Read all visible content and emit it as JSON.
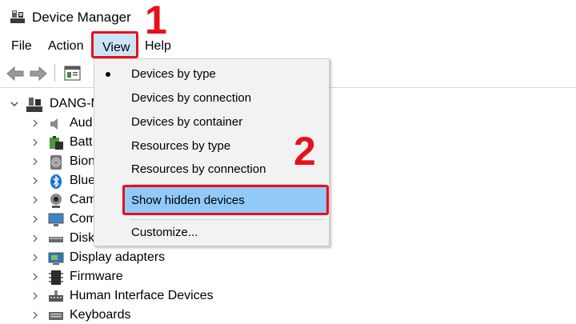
{
  "window": {
    "title": "Device Manager"
  },
  "menubar": {
    "file": "File",
    "action": "Action",
    "view": "View",
    "help": "Help"
  },
  "tree": {
    "root": "DANG-M",
    "items": [
      {
        "label": "Aud",
        "icon": "speaker-icon"
      },
      {
        "label": "Batt",
        "icon": "battery-icon"
      },
      {
        "label": "Bion",
        "icon": "fingerprint-icon"
      },
      {
        "label": "Blue",
        "icon": "bluetooth-icon"
      },
      {
        "label": "Cam",
        "icon": "camera-icon"
      },
      {
        "label": "Com",
        "icon": "monitor-icon"
      },
      {
        "label": "Disk",
        "icon": "disk-drive-icon"
      },
      {
        "label": "Display adapters",
        "icon": "display-adapter-icon"
      },
      {
        "label": "Firmware",
        "icon": "firmware-icon"
      },
      {
        "label": "Human Interface Devices",
        "icon": "hid-icon"
      },
      {
        "label": "Keyboards",
        "icon": "keyboard-icon"
      }
    ]
  },
  "view_menu": {
    "devices_by_type": "Devices by type",
    "devices_by_connection": "Devices by connection",
    "devices_by_container": "Devices by container",
    "resources_by_type": "Resources by type",
    "resources_by_connection": "Resources by connection",
    "show_hidden_devices": "Show hidden devices",
    "customize": "Customize..."
  },
  "annotations": {
    "step1": "1",
    "step2": "2"
  },
  "colors": {
    "highlight_border": "#e8101a",
    "menu_hover": "#91c9f7",
    "view_selected": "#cce4f7"
  }
}
